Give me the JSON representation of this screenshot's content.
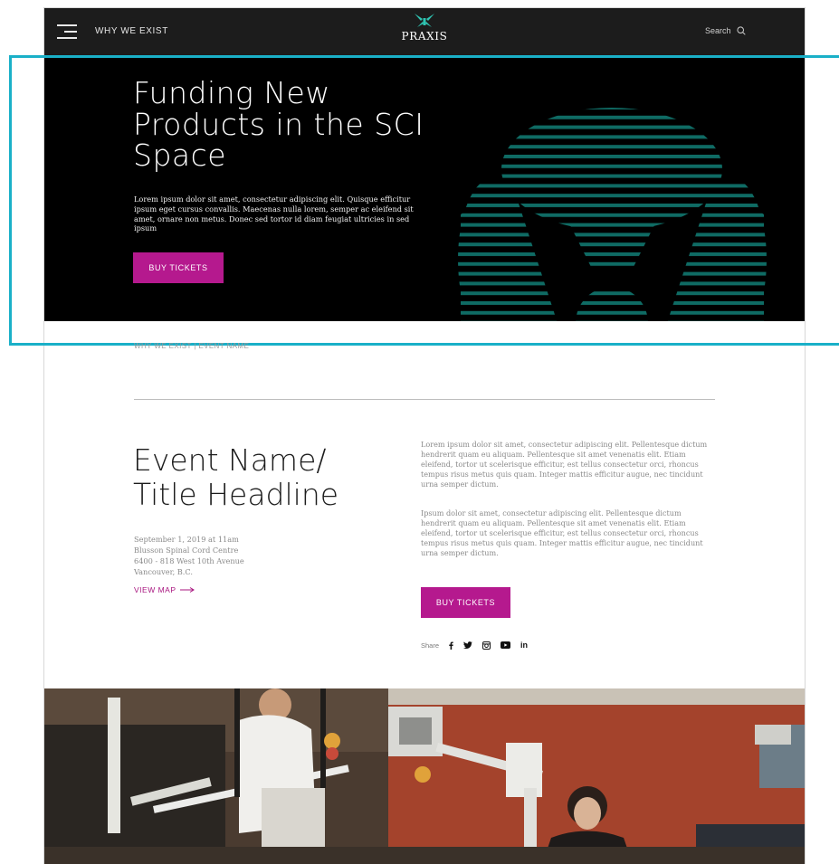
{
  "nav": {
    "link": "WHY WE EXIST",
    "logo_text": "PRAXIS",
    "search_label": "Search"
  },
  "hero": {
    "title": "Funding New Products in the SCI Space",
    "body": "Lorem ipsum dolor sit amet, consectetur adipiscing elit. Quisque efficitur ipsum eget cursus convallis. Maecenas nulla lorem, semper ac eleifend sit amet, ornare non metus. Donec sed tortor id diam feugiat ultricies in sed ipsum",
    "button_label": "BUY TICKETS"
  },
  "breadcrumb": "WHY WE EXIST | EVENT NAME",
  "event": {
    "title_line1": "Event Name/",
    "title_line2": "Title Headline",
    "date": "September 1, 2019 at 11am",
    "venue": "Blusson Spinal Cord Centre",
    "address": "6400 - 818 West 10th Avenue",
    "city": "Vancouver, B.C.",
    "map_link": "VIEW MAP",
    "paragraph1": "Lorem ipsum dolor sit amet, consectetur adipiscing elit. Pellentesque dictum hendrerit quam eu aliquam. Pellentesque sit amet venenatis elit. Etiam eleifend, tortor ut scelerisque efficitur, est tellus consectetur orci, rhoncus tempus risus metus quis quam. Integer mattis efficitur augue, nec tincidunt urna semper dictum.",
    "paragraph2": "Ipsum dolor sit amet, consectetur adipiscing elit. Pellentesque dictum hendrerit quam eu aliquam. Pellentesque sit amet venenatis elit. Etiam eleifend, tortor ut scelerisque efficitur, est tellus consectetur orci, rhoncus tempus risus metus quis quam. Integer mattis efficitur augue, nec tincidunt urna semper dictum.",
    "button_label": "BUY TICKETS",
    "share_label": "Share"
  },
  "colors": {
    "accent": "#b5198e",
    "hero_stripes": "#0f6b64",
    "selection_outline": "#1ab0c8"
  },
  "icons": [
    "hamburger-icon",
    "praxis-logo-icon",
    "search-icon",
    "arrow-right-icon",
    "facebook-icon",
    "twitter-icon",
    "instagram-icon",
    "youtube-icon",
    "linkedin-icon"
  ]
}
